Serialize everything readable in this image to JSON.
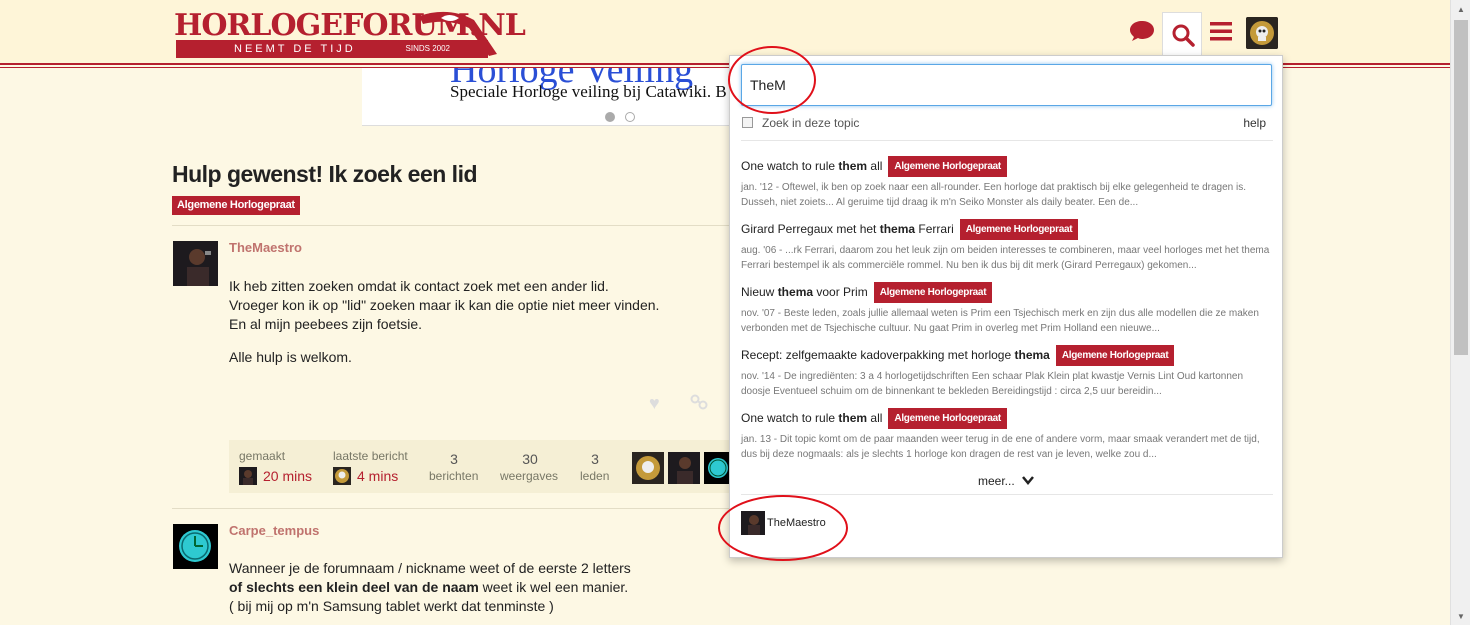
{
  "header": {
    "logo_text": "HORLOGEFORUM.NL",
    "logo_tagline": "NEEMT DE TIJD",
    "logo_since": "SINDS 2002",
    "icons": [
      "chat-icon",
      "search-icon",
      "menu-icon",
      "user-avatar"
    ]
  },
  "banner": {
    "title": "Horloge Veiling",
    "subtitle": "Speciale Horloge veiling bij Catawiki. B"
  },
  "topic": {
    "title": "Hulp gewenst! Ik zoek een lid",
    "category": "Algemene Horlogepraat"
  },
  "posts": [
    {
      "username": "TheMaestro",
      "paragraphs": [
        "Ik heb zitten zoeken omdat ik contact zoek met een ander lid.",
        "Vroeger kon ik op \"lid\" zoeken maar ik kan die optie niet meer vinden.",
        "En al mijn peebees zijn foetsie.",
        "Alle hulp is welkom."
      ]
    },
    {
      "username": "Carpe_tempus",
      "line1": "Wanneer je de forumnaam / nickname weet of de eerste 2 letters",
      "line2_bold": "of slechts een klein deel van de naam",
      "line2_rest": " weet ik wel een manier.",
      "line3": "( bij mij op m'n Samsung tablet werkt dat tenminste )"
    }
  ],
  "stats": {
    "created_label": "gemaakt",
    "created_value": "20 mins",
    "last_label": "laatste bericht",
    "last_value": "4 mins",
    "posts_num": "3",
    "posts_label": "berichten",
    "views_num": "30",
    "views_label": "weergaves",
    "members_num": "3",
    "members_label": "leden"
  },
  "search": {
    "query": "TheM",
    "checkbox_label": "Zoek in deze topic",
    "help": "help",
    "results": [
      {
        "title_pre": "One watch to rule ",
        "title_bold": "them",
        "title_post": " all",
        "category": "Algemene Horlogepraat",
        "blurb": "jan. '12 - Oftewel, ik ben op zoek naar een all-rounder. Een horloge dat praktisch bij elke gelegenheid te dragen is. Dusseh, niet zoiets... Al geruime tijd draag ik m'n Seiko Monster als daily beater. Een de..."
      },
      {
        "title_pre": "Girard Perregaux met het ",
        "title_bold": "thema",
        "title_post": " Ferrari",
        "category": "Algemene Horlogepraat",
        "blurb": "aug. '06 - ...rk Ferrari, daarom zou het leuk zijn om beiden interesses te combineren, maar veel horloges met het thema Ferrari bestempel ik als commerciële rommel. Nu ben ik dus bij dit merk (Girard Perregaux) gekomen..."
      },
      {
        "title_pre": "Nieuw ",
        "title_bold": "thema",
        "title_post": " voor Prim",
        "category": "Algemene Horlogepraat",
        "blurb": "nov. '07 - Beste leden, zoals jullie allemaal weten is Prim een Tsjechisch merk en zijn dus alle modellen die ze maken verbonden met de Tsjechische cultuur. Nu gaat Prim in overleg met Prim Holland een nieuwe..."
      },
      {
        "title_pre": "Recept: zelfgemaakte kadoverpakking met horloge ",
        "title_bold": "thema",
        "title_post": "",
        "category": "Algemene Horlogepraat",
        "blurb": "nov. '14 - De ingrediënten: 3 a 4 horlogetijdschriften Een schaar Plak Klein plat kwastje Vernis Lint Oud kartonnen doosje Eventueel schuim om de binnenkant te bekleden Bereidingstijd : circa 2,5 uur bereidin..."
      },
      {
        "title_pre": "One watch to rule ",
        "title_bold": "them",
        "title_post": " all",
        "category": "Algemene Horlogepraat",
        "blurb": "jan. 13 - Dit topic komt om de paar maanden weer terug in de ene of andere vorm, maar smaak verandert met de tijd, dus bij deze nogmaals: als je slechts 1 horloge kon dragen de rest van je leven, welke zou d..."
      }
    ],
    "more_label": "meer...",
    "user_result": "TheMaestro"
  },
  "colors": {
    "brand": "#b5202f",
    "background": "#fdf8e4",
    "annotation": "#e0101a"
  }
}
